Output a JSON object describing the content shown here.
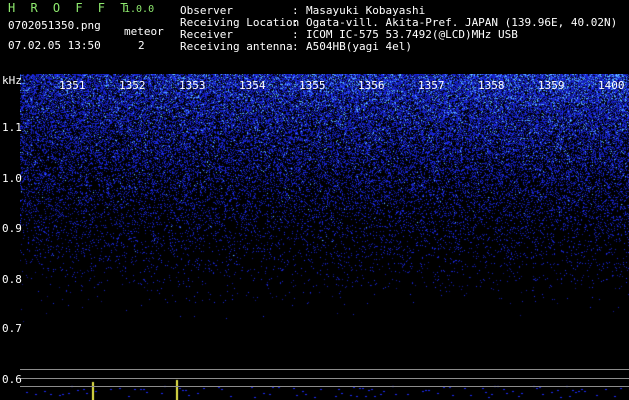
{
  "app": {
    "name": "H R O F F T",
    "version": "1.0.0"
  },
  "file": {
    "name": "0702051350.png",
    "timestamp": "07.02.05 13:50"
  },
  "meteor": {
    "label": "meteor",
    "count": "2"
  },
  "info": [
    {
      "key": "Observer",
      "sep": ":",
      "value": "Masayuki Kobayashi"
    },
    {
      "key": "Receiving Location",
      "sep": ":",
      "value": "Ogata-vill. Akita-Pref. JAPAN (139.96E, 40.02N)"
    },
    {
      "key": "Receiver",
      "sep": ":",
      "value": "ICOM IC-575 53.7492(@LCD)MHz USB"
    },
    {
      "key": "Receiving antenna",
      "sep": ":",
      "value": "A504HB(yagi 4el)"
    }
  ],
  "spectrogram": {
    "unit": "kHz",
    "y_ticks": [
      "1.1",
      "1.0",
      "0.9",
      "0.8",
      "0.7",
      "0.6"
    ],
    "x_ticks": [
      "1351",
      "1352",
      "1353",
      "1354",
      "1355",
      "1356",
      "1357",
      "1358",
      "1359",
      "1400"
    ],
    "colors": {
      "noise": "#1e2cff",
      "bright": "#7fdfff",
      "signal": "#e8e84a",
      "line": "#8c8c8c"
    }
  }
}
